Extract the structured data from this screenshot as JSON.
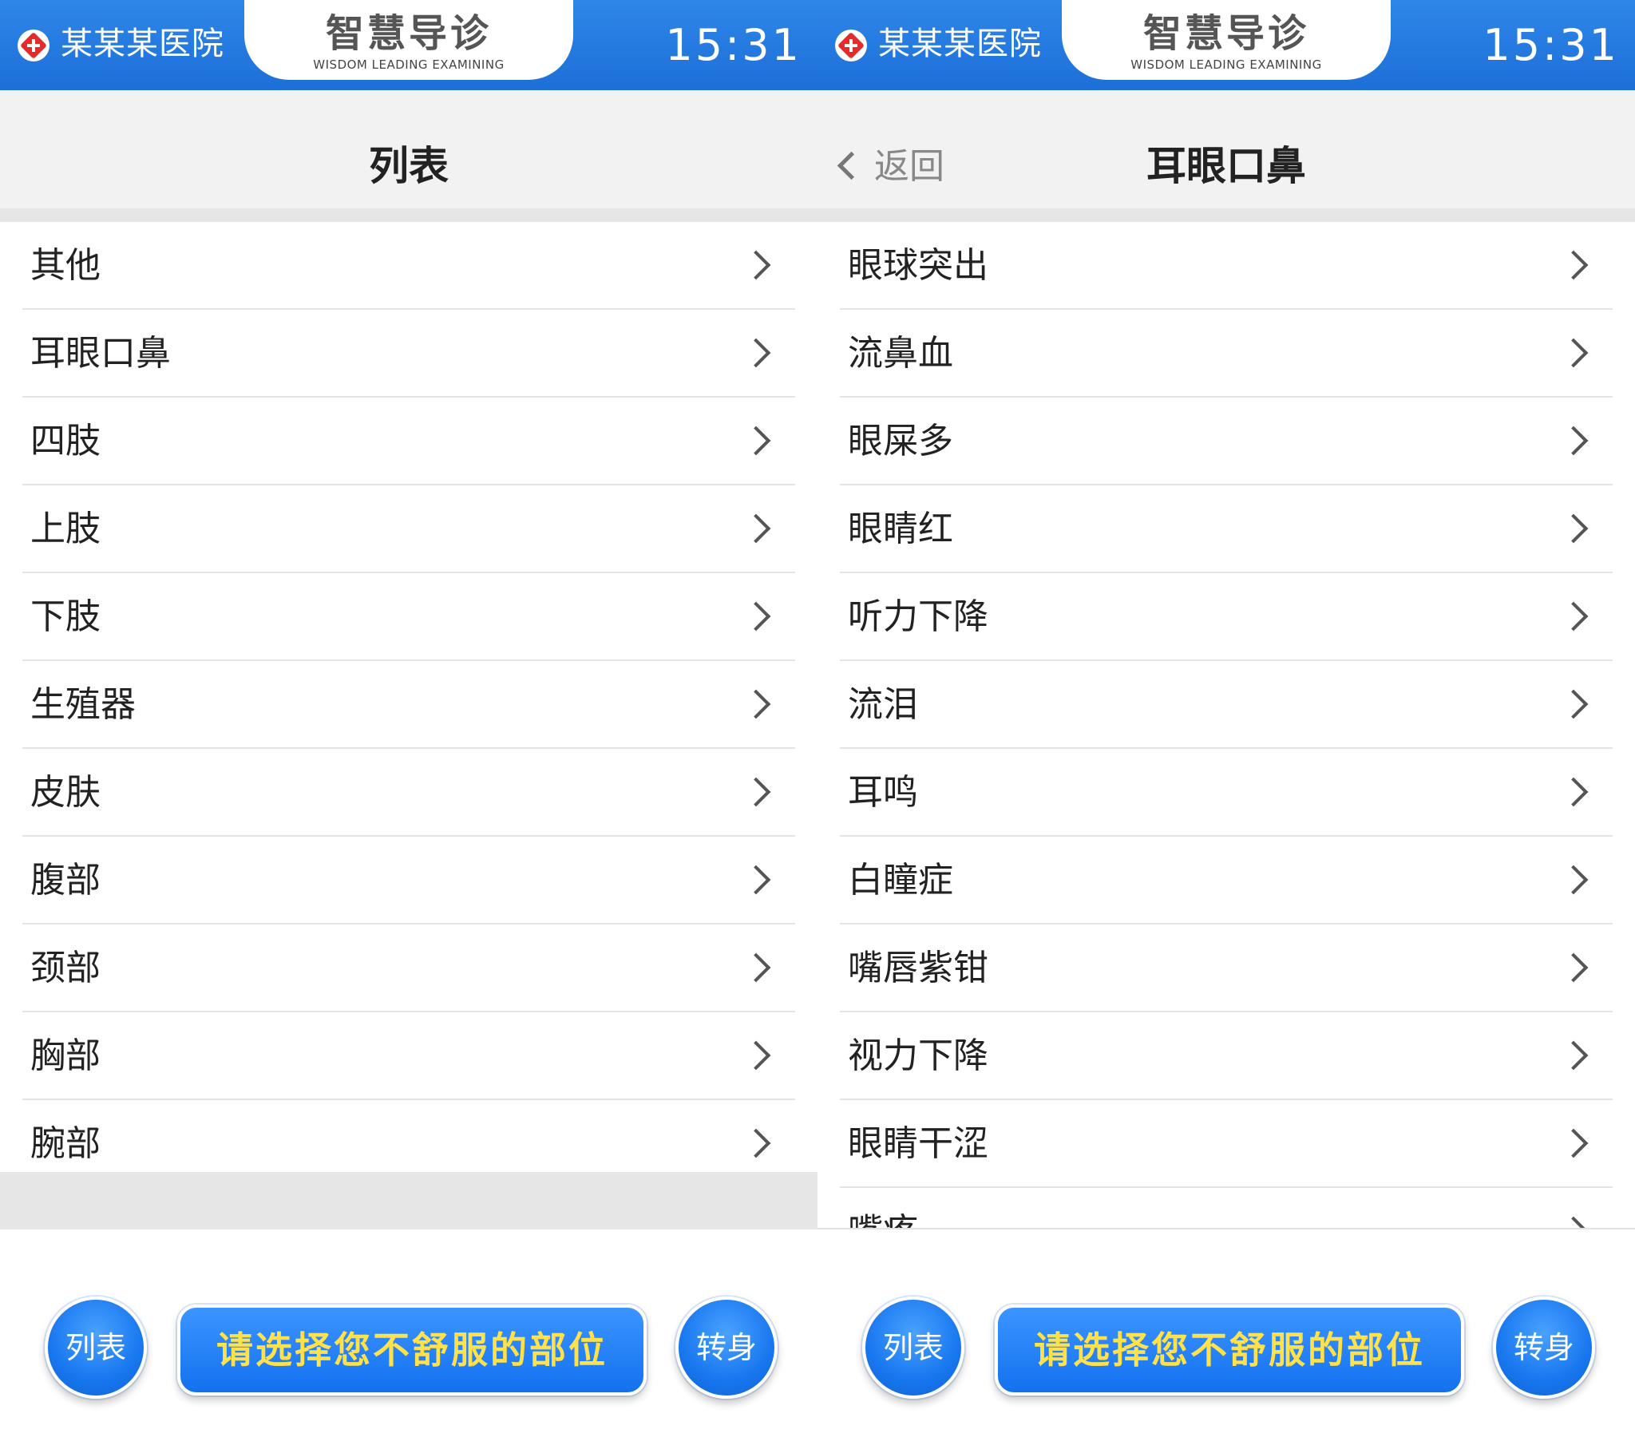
{
  "status_bar": {
    "hospital_name": "某某某医院",
    "app_title": "智慧导诊",
    "app_subtitle": "WISDOM LEADING EXAMINING",
    "time": "15:31"
  },
  "left_screen": {
    "header_title": "列表",
    "items": [
      "其他",
      "耳眼口鼻",
      "四肢",
      "上肢",
      "下肢",
      "生殖器",
      "皮肤",
      "腹部",
      "颈部",
      "胸部",
      "腕部"
    ]
  },
  "right_screen": {
    "back_label": "返回",
    "header_title": "耳眼口鼻",
    "items": [
      "眼球突出",
      "流鼻血",
      "眼屎多",
      "眼睛红",
      "听力下降",
      "流泪",
      "耳鸣",
      "白瞳症",
      "嘴唇紫钳",
      "视力下降",
      "眼睛干涩",
      "嘴疼"
    ]
  },
  "bottom_bar": {
    "list_button": "列表",
    "prompt_button": "请选择您不舒服的部位",
    "turn_button": "转身"
  },
  "colors": {
    "top_bar": "#1c6fd8",
    "button_blue": "#1877ef",
    "prompt_text": "#ffe14a",
    "hospital_icon": "#e32b2b"
  },
  "icons": {
    "hospital": "hospital-cross-icon",
    "row_arrow": "chevron-right-icon",
    "back": "chevron-left-icon"
  }
}
